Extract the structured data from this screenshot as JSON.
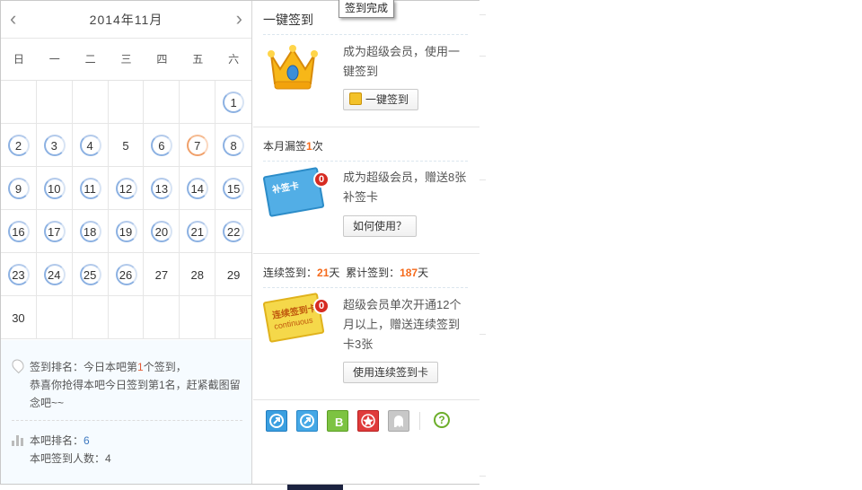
{
  "calendar": {
    "title": "2014年11月",
    "prev_icon": "chevron-left-icon",
    "next_icon": "chevron-right-icon",
    "weekdays": [
      "日",
      "一",
      "二",
      "三",
      "四",
      "五",
      "六"
    ],
    "weeks": [
      [
        {
          "d": "",
          "s": ""
        },
        {
          "d": "",
          "s": ""
        },
        {
          "d": "",
          "s": ""
        },
        {
          "d": "",
          "s": ""
        },
        {
          "d": "",
          "s": ""
        },
        {
          "d": "",
          "s": ""
        },
        {
          "d": "1",
          "s": "signed"
        }
      ],
      [
        {
          "d": "2",
          "s": "signed"
        },
        {
          "d": "3",
          "s": "signed"
        },
        {
          "d": "4",
          "s": "signed"
        },
        {
          "d": "5",
          "s": ""
        },
        {
          "d": "6",
          "s": "signed"
        },
        {
          "d": "7",
          "s": "missed"
        },
        {
          "d": "8",
          "s": "signed"
        }
      ],
      [
        {
          "d": "9",
          "s": "signed"
        },
        {
          "d": "10",
          "s": "signed"
        },
        {
          "d": "11",
          "s": "signed"
        },
        {
          "d": "12",
          "s": "signed"
        },
        {
          "d": "13",
          "s": "signed"
        },
        {
          "d": "14",
          "s": "signed"
        },
        {
          "d": "15",
          "s": "signed"
        }
      ],
      [
        {
          "d": "16",
          "s": "signed"
        },
        {
          "d": "17",
          "s": "signed"
        },
        {
          "d": "18",
          "s": "signed"
        },
        {
          "d": "19",
          "s": "signed"
        },
        {
          "d": "20",
          "s": "signed"
        },
        {
          "d": "21",
          "s": "signed"
        },
        {
          "d": "22",
          "s": "signed"
        }
      ],
      [
        {
          "d": "23",
          "s": "signed"
        },
        {
          "d": "24",
          "s": "signed"
        },
        {
          "d": "25",
          "s": "signed"
        },
        {
          "d": "26",
          "s": "signed"
        },
        {
          "d": "27",
          "s": ""
        },
        {
          "d": "28",
          "s": ""
        },
        {
          "d": "29",
          "s": ""
        }
      ],
      [
        {
          "d": "30",
          "s": ""
        },
        {
          "d": "",
          "s": ""
        },
        {
          "d": "",
          "s": ""
        },
        {
          "d": "",
          "s": ""
        },
        {
          "d": "",
          "s": ""
        },
        {
          "d": "",
          "s": ""
        },
        {
          "d": "",
          "s": ""
        }
      ]
    ],
    "ranking": {
      "line1_prefix": "签到排名：今日本吧第",
      "line1_rank": "1",
      "line1_suffix": "个签到，",
      "line2": "恭喜你抢得本吧今日签到第1名，赶紧截图留念吧~~",
      "bar_rank_label": "本吧排名：",
      "bar_rank_value": "6",
      "sign_count_label": "本吧签到人数：",
      "sign_count_value": "4"
    }
  },
  "side": {
    "title": "一键签到",
    "tooltip": "签到完成",
    "vip": {
      "desc": "成为超级会员，使用一键签到",
      "button": "一键签到",
      "image": "crown-icon"
    },
    "missed": {
      "prefix": "本月漏签",
      "count": "1",
      "suffix": "次",
      "desc": "成为超级会员，赠送8张补签卡",
      "button": "如何使用？",
      "card_label": "补签卡",
      "card_badge": "0"
    },
    "continuous": {
      "label1": "连续签到：",
      "days": "21",
      "unit1": "天",
      "label2": "累计签到：",
      "total": "187",
      "unit2": "天",
      "desc": "超级会员单次开通12个月以上，赠送连续签到卡3张",
      "button": "使用连续签到卡",
      "card_label": "连续签到卡",
      "card_label2": "continuous",
      "card_badge": "0"
    },
    "icons": [
      "arrow-up-badge-icon",
      "arrow-up-badge-icon",
      "b-badge-icon",
      "star-badge-icon",
      "ghost-badge-icon",
      "help-icon"
    ],
    "help": "?"
  },
  "colors": {
    "signed_ring": "#8cb1e2",
    "missed_ring": "#f0a06a",
    "accent_orange": "#f56a1b",
    "accent_red": "#e45b36"
  }
}
